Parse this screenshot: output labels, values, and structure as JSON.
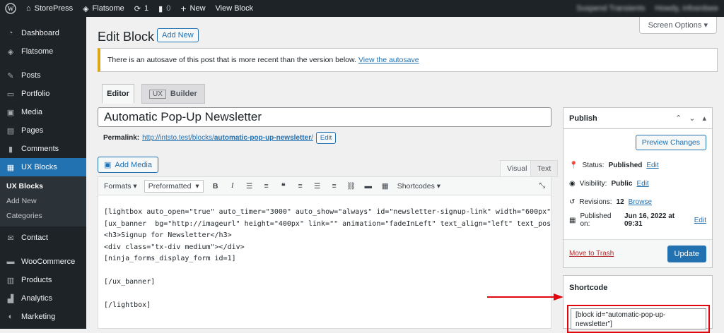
{
  "adminbar": {
    "site_name": "StorePress",
    "theme": "Flatsome",
    "updates_count": "1",
    "comments_count": "0",
    "new_label": "New",
    "view_label": "View Block",
    "right_item_1": "Suspend Transients",
    "right_item_2": "Howdy, infosrdsee"
  },
  "sidebar": {
    "items": [
      {
        "label": "Dashboard",
        "icon": "dashboard-icon"
      },
      {
        "label": "Flatsome",
        "icon": "flatsome-icon"
      },
      {
        "label": "Posts",
        "icon": "pin-icon"
      },
      {
        "label": "Portfolio",
        "icon": "folder-icon"
      },
      {
        "label": "Media",
        "icon": "media-icon"
      },
      {
        "label": "Pages",
        "icon": "pages-icon"
      },
      {
        "label": "Comments",
        "icon": "comment-icon"
      },
      {
        "label": "UX Blocks",
        "icon": "blocks-icon"
      },
      {
        "label": "Contact",
        "icon": "mail-icon"
      },
      {
        "label": "WooCommerce",
        "icon": "woo-icon"
      },
      {
        "label": "Products",
        "icon": "products-icon"
      },
      {
        "label": "Analytics",
        "icon": "analytics-icon"
      },
      {
        "label": "Marketing",
        "icon": "megaphone-icon"
      }
    ],
    "submenu": [
      "UX Blocks",
      "Add New",
      "Categories"
    ]
  },
  "header": {
    "title": "Edit Block",
    "add_new": "Add New",
    "screen_options": "Screen Options"
  },
  "notice": {
    "text": "There is an autosave of this post that is more recent than the version below.",
    "link": "View the autosave"
  },
  "tabs": {
    "editor": "Editor",
    "ux_badge": "UX",
    "builder": "Builder"
  },
  "post": {
    "title": "Automatic Pop-Up Newsletter",
    "permalink_label": "Permalink:",
    "permalink_base": "http://intsto.test/blocks/",
    "permalink_slug": "automatic-pop-up-newsletter",
    "permalink_end": "/",
    "edit": "Edit"
  },
  "editor": {
    "add_media": "Add Media",
    "tab_visual": "Visual",
    "tab_text": "Text",
    "format": "Formats",
    "paragraph": "Preformatted",
    "shortcodes": "Shortcodes",
    "lines": [
      "[lightbox auto_open=\"true\" auto_timer=\"3000\" auto_show=\"always\" id=\"newsletter-signup-link\" width=\"600px\"",
      "",
      "[ux_banner  bg=\"http://imageurl\" height=\"400px\" link=\"\" animation=\"fadeInLeft\" text_align=\"left\" text_pos=",
      "<h3>Signup for Newsletter</h3>",
      "<div class=\"tx-div medium\"></div>",
      "[ninja_forms_display_form id=1]",
      "",
      "[/ux_banner]",
      "",
      "[/lightbox]"
    ]
  },
  "publish": {
    "title": "Publish",
    "preview": "Preview Changes",
    "status_label": "Status:",
    "status_value": "Published",
    "visibility_label": "Visibility:",
    "visibility_value": "Public",
    "revisions_label": "Revisions:",
    "revisions_value": "12",
    "browse": "Browse",
    "published_label": "Published on:",
    "published_value": "Jun 16, 2022 at 09:31",
    "edit": "Edit",
    "trash": "Move to Trash",
    "update": "Update"
  },
  "shortcode": {
    "title": "Shortcode",
    "value": "[block id=\"automatic-pop-up-newsletter\"]"
  },
  "colors": {
    "accent": "#2271b1",
    "highlight": "#e0070e",
    "adminbar": "#1d2327"
  }
}
